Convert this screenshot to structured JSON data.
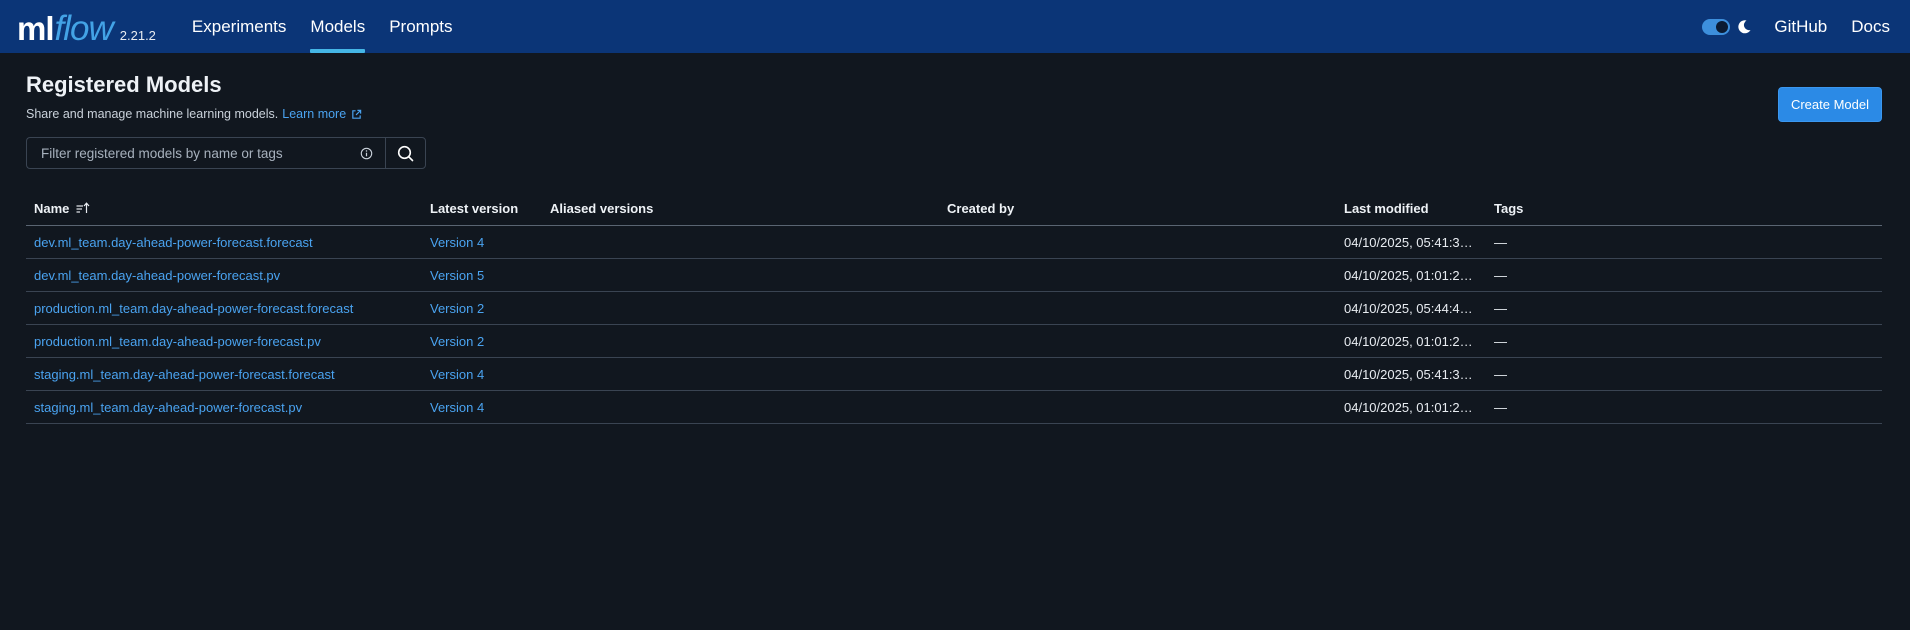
{
  "header": {
    "logo_ml": "ml",
    "logo_flow": "flow",
    "version": "2.21.2",
    "nav": [
      {
        "label": "Experiments",
        "active": false
      },
      {
        "label": "Models",
        "active": true
      },
      {
        "label": "Prompts",
        "active": false
      }
    ],
    "github": "GitHub",
    "docs": "Docs",
    "theme_toggle": "on"
  },
  "page": {
    "title": "Registered Models",
    "subtitle": "Share and manage machine learning models.",
    "learn_more": "Learn more",
    "create_button": "Create Model"
  },
  "search": {
    "placeholder": "Filter registered models by name or tags",
    "value": ""
  },
  "table": {
    "columns": [
      "Name",
      "Latest version",
      "Aliased versions",
      "Created by",
      "Last modified",
      "Tags"
    ],
    "rows": [
      {
        "name": "dev.ml_team.day-ahead-power-forecast.forecast",
        "latest": "Version 4",
        "aliased": "",
        "created_by": "",
        "modified": "04/10/2025, 05:41:3…",
        "tags": "—"
      },
      {
        "name": "dev.ml_team.day-ahead-power-forecast.pv",
        "latest": "Version 5",
        "aliased": "",
        "created_by": "",
        "modified": "04/10/2025, 01:01:2…",
        "tags": "—"
      },
      {
        "name": "production.ml_team.day-ahead-power-forecast.forecast",
        "latest": "Version 2",
        "aliased": "",
        "created_by": "",
        "modified": "04/10/2025, 05:44:4…",
        "tags": "—"
      },
      {
        "name": "production.ml_team.day-ahead-power-forecast.pv",
        "latest": "Version 2",
        "aliased": "",
        "created_by": "",
        "modified": "04/10/2025, 01:01:2…",
        "tags": "—"
      },
      {
        "name": "staging.ml_team.day-ahead-power-forecast.forecast",
        "latest": "Version 4",
        "aliased": "",
        "created_by": "",
        "modified": "04/10/2025, 05:41:3…",
        "tags": "—"
      },
      {
        "name": "staging.ml_team.day-ahead-power-forecast.pv",
        "latest": "Version 4",
        "aliased": "",
        "created_by": "",
        "modified": "04/10/2025, 01:01:2…",
        "tags": "—"
      }
    ]
  },
  "colors": {
    "header_bg": "#0b3577",
    "page_bg": "#11171f",
    "accent": "#2b8ae6",
    "link": "#4aa3f0",
    "active_tab_underline": "#45b6e6"
  },
  "icons": {
    "theme": "moon-icon",
    "external_link": "external-link-icon",
    "info": "info-icon",
    "search": "search-icon",
    "sort": "sort-ascending-icon"
  }
}
